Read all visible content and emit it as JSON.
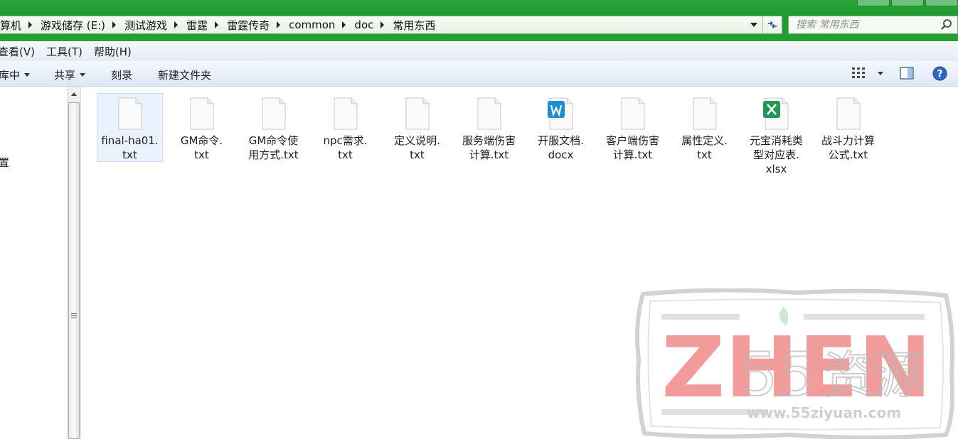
{
  "address": {
    "crumbs": [
      "算机",
      "游戏储存 (E:)",
      "测试游戏",
      "雷霆",
      "雷霆传奇",
      "common",
      "doc",
      "常用东西"
    ]
  },
  "search": {
    "placeholder": "搜索 常用东西"
  },
  "menu": [
    "查看(V)",
    "工具(T)",
    "帮助(H)"
  ],
  "toolbar": {
    "include_library": "库中",
    "share": "共享",
    "burn": "刻录",
    "new_folder": "新建文件夹"
  },
  "nav": {
    "visible_item": "置"
  },
  "files": [
    {
      "name": "final-ha01.\ntxt",
      "type": "txt",
      "selected": true
    },
    {
      "name": "GM命令.\ntxt",
      "type": "txt"
    },
    {
      "name": "GM命令使\n用方式.txt",
      "type": "txt"
    },
    {
      "name": "npc需求.\ntxt",
      "type": "txt"
    },
    {
      "name": "定义说明.\ntxt",
      "type": "txt"
    },
    {
      "name": "服务端伤害\n计算.txt",
      "type": "txt"
    },
    {
      "name": "开服文档.\ndocx",
      "type": "docx"
    },
    {
      "name": "客户端伤害\n计算.txt",
      "type": "txt"
    },
    {
      "name": "属性定义.\ntxt",
      "type": "txt"
    },
    {
      "name": "元宝消耗类\n型对应表.\nxlsx",
      "type": "xlsx"
    },
    {
      "name": "战斗力计算\n公式.txt",
      "type": "txt"
    }
  ],
  "watermark": {
    "brand": "ZHEN",
    "cn": "资源",
    "url": "www.55ziyuan.com"
  },
  "colors": {
    "titlebar": "#22a133",
    "selection": "#eaf3fd",
    "docx": "#1a8fd6",
    "xlsx": "#1e9a56",
    "watermark": "#ef7f7f"
  }
}
